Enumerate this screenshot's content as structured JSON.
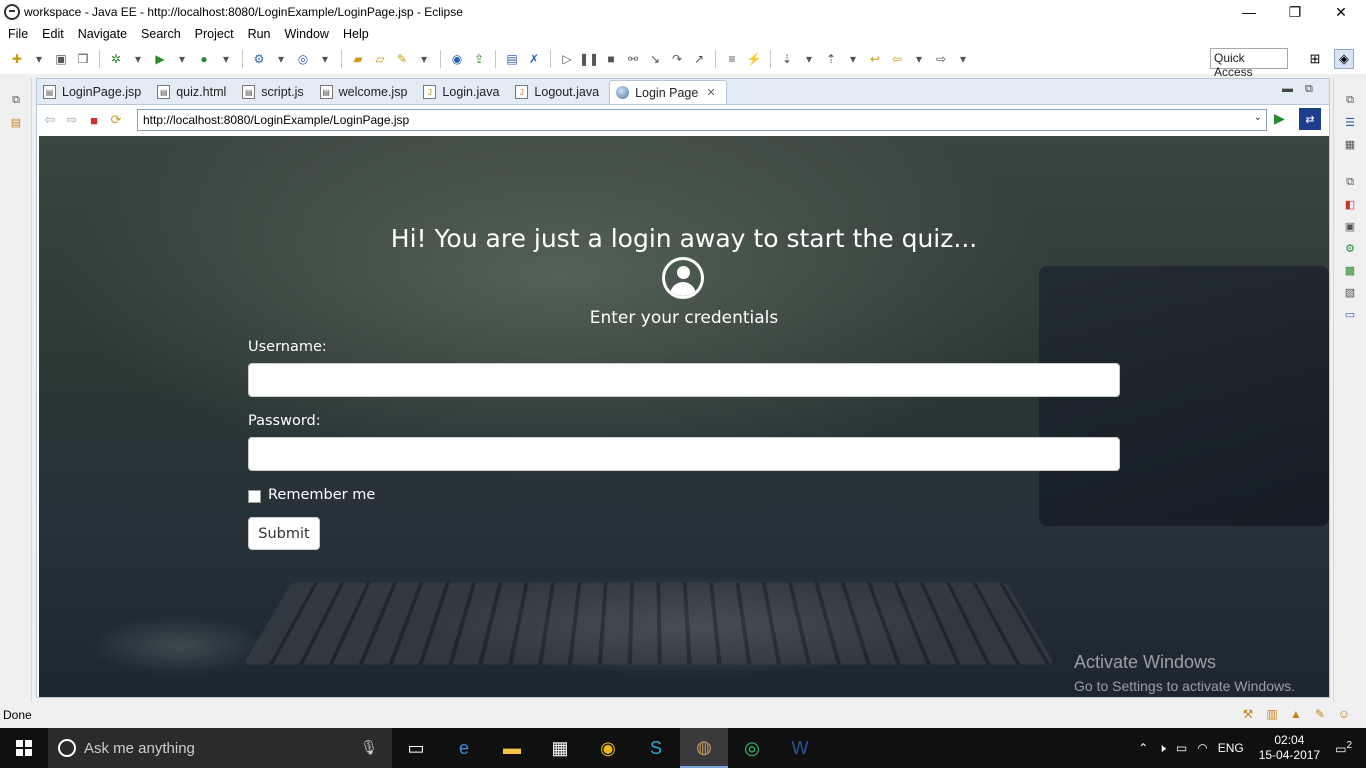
{
  "window": {
    "title": "workspace - Java EE - http://localhost:8080/LoginExample/LoginPage.jsp - Eclipse",
    "minimize": "—",
    "restore": "❐",
    "close": "✕"
  },
  "menu": [
    "File",
    "Edit",
    "Navigate",
    "Search",
    "Project",
    "Run",
    "Window",
    "Help"
  ],
  "quick_access": "Quick Access",
  "tabs": [
    {
      "label": "LoginPage.jsp",
      "icon": "jsp-file-icon"
    },
    {
      "label": "quiz.html",
      "icon": "html-file-icon"
    },
    {
      "label": "script.js",
      "icon": "js-file-icon"
    },
    {
      "label": "welcome.jsp",
      "icon": "jsp-file-icon"
    },
    {
      "label": "Login.java",
      "icon": "java-file-icon"
    },
    {
      "label": "Logout.java",
      "icon": "java-file-icon"
    },
    {
      "label": "Login Page",
      "icon": "browser-globe-icon",
      "active": true
    }
  ],
  "browser": {
    "url": "http://localhost:8080/LoginExample/LoginPage.jsp"
  },
  "page": {
    "heading": "Hi! You are just a login away to start the quiz...",
    "subheading": "Enter your credentials",
    "username_label": "Username:",
    "username_value": "",
    "password_label": "Password:",
    "password_value": "",
    "remember_label": "Remember me",
    "remember_checked": false,
    "submit_label": "Submit"
  },
  "watermark": {
    "line1": "Activate Windows",
    "line2": "Go to Settings to activate Windows."
  },
  "status": "Done",
  "taskbar": {
    "search_placeholder": "Ask me anything",
    "language": "ENG",
    "time": "02:04",
    "date": "15-04-2017",
    "notifications": "2"
  }
}
